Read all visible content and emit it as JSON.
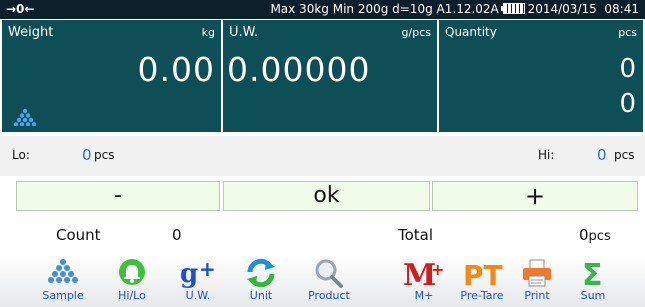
{
  "status": {
    "zero_indicator": "→0←",
    "info": "Max 30kg  Min 200g  d=10g   A1.12.02A",
    "date": "2014/03/15",
    "time": "08:41"
  },
  "panels": {
    "weight": {
      "label": "Weight",
      "unit": "kg",
      "value": "0.00"
    },
    "uw": {
      "label": "U.W.",
      "unit": "g/pcs",
      "value": "0.00000"
    },
    "quantity": {
      "label": "Quantity",
      "unit": "pcs",
      "value1": "0",
      "value2": "0"
    }
  },
  "limits": {
    "lo_label": "Lo:",
    "lo_value": "0",
    "lo_unit": "pcs",
    "hi_label": "Hi:",
    "hi_value": "0",
    "hi_unit": "pcs"
  },
  "keys": {
    "minus": "-",
    "ok": "ok",
    "plus": "+"
  },
  "count": {
    "label": "Count",
    "value": "0",
    "total_label": "Total",
    "total_value": "0",
    "total_unit": "pcs"
  },
  "toolbar": [
    {
      "label": "Sample",
      "icon": "pyramid-icon"
    },
    {
      "label": "Hi/Lo",
      "icon": "bell-icon"
    },
    {
      "label": "U.W.",
      "icon": "gplus-icon"
    },
    {
      "label": "Unit",
      "icon": "refresh-icon"
    },
    {
      "label": "Product",
      "icon": "magnifier-icon"
    },
    {
      "label": "M+",
      "icon": "mplus-icon"
    },
    {
      "label": "Pre-Tare",
      "icon": "pt-icon"
    },
    {
      "label": "Print",
      "icon": "printer-icon"
    },
    {
      "label": "Sum",
      "icon": "sigma-icon"
    }
  ],
  "colors": {
    "panel": "#0e4e57",
    "statusbar": "#0d1f2a",
    "accent_blue": "#2a74d6",
    "key_bg": "#f1fbe9"
  }
}
